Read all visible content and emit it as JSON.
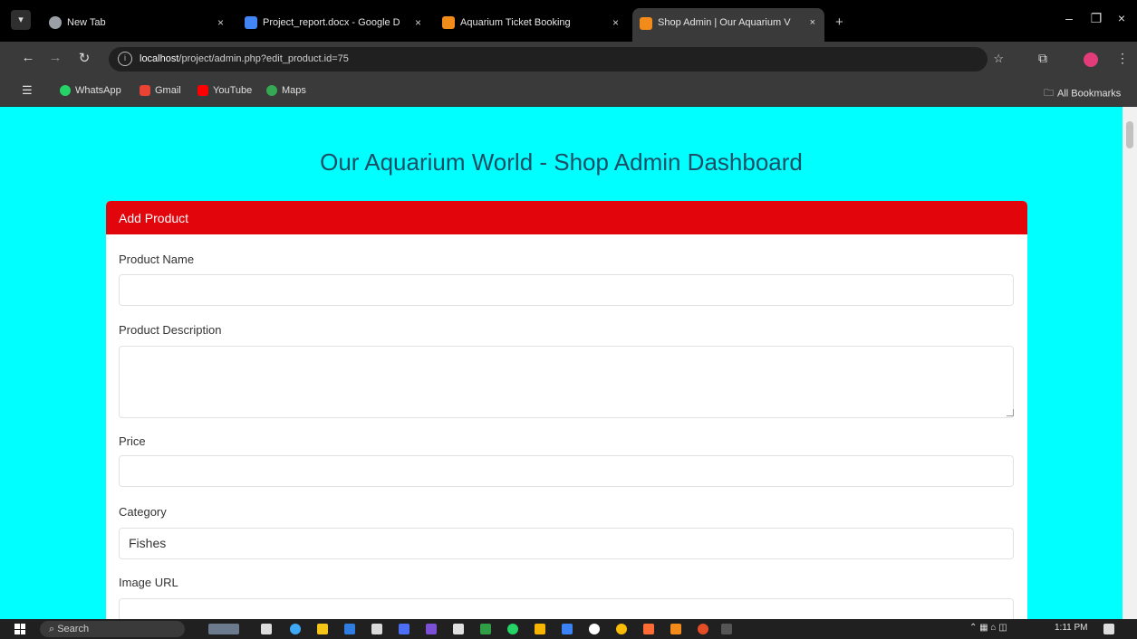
{
  "browser": {
    "tabs": [
      {
        "label": "New Tab",
        "active": false,
        "color": "#9aa0a6"
      },
      {
        "label": "Project_report.docx - Google D",
        "active": false,
        "color": "#4285f4"
      },
      {
        "label": "Aquarium Ticket Booking",
        "active": false,
        "color": "#f28b1a"
      },
      {
        "label": "Shop Admin | Our Aquarium V",
        "active": true,
        "color": "#f28b1a"
      }
    ],
    "url_host": "localhost",
    "url_path": "/project/admin.php?edit_product.id=75",
    "bookmarks": [
      {
        "label": "WhatsApp",
        "color": "#25d366"
      },
      {
        "label": "Gmail",
        "color": "#ea4335"
      },
      {
        "label": "YouTube",
        "color": "#ff0000"
      },
      {
        "label": "Maps",
        "color": "#34a853"
      }
    ],
    "all_bookmarks": "All Bookmarks"
  },
  "page": {
    "title": "Our Aquarium World - Shop Admin Dashboard",
    "background": "#00ffff",
    "card_header": "Add Product",
    "header_color": "#e3050c",
    "fields": {
      "name_label": "Product Name",
      "name_value": "",
      "description_label": "Product Description",
      "description_value": "",
      "price_label": "Price",
      "price_value": "",
      "category_label": "Category",
      "category_value": "Fishes",
      "image_label": "Image URL",
      "image_value": ""
    }
  },
  "taskbar": {
    "search_label": "Search",
    "time": "1:11 PM"
  }
}
